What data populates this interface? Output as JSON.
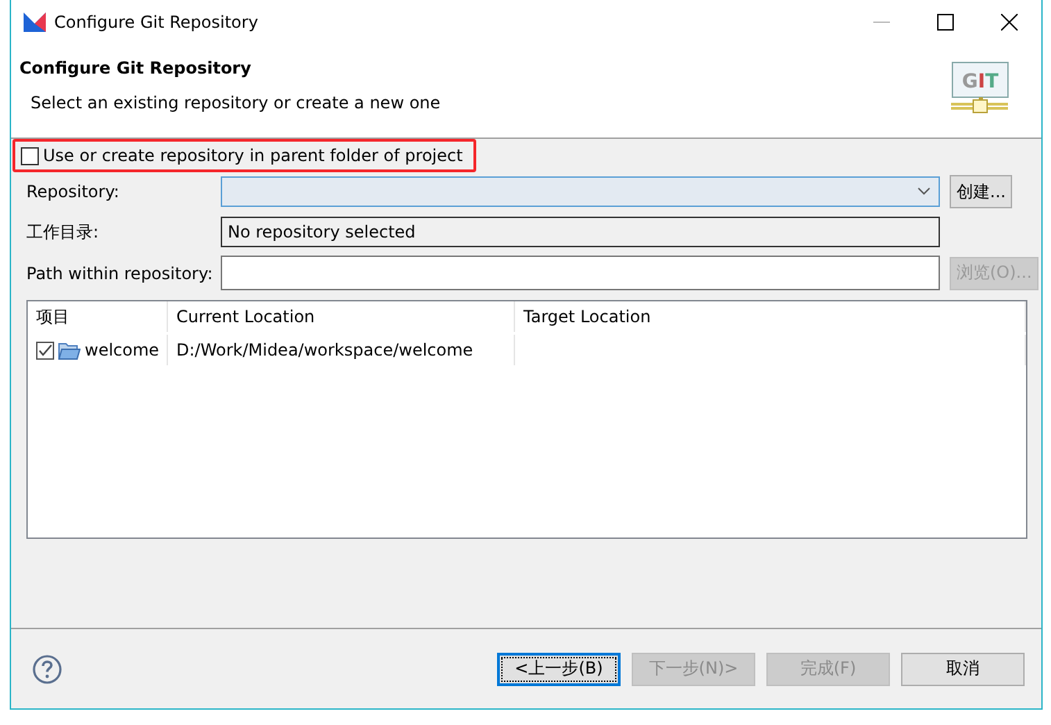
{
  "window": {
    "title": "Configure Git Repository"
  },
  "header": {
    "title": "Configure Git Repository",
    "description": "Select an existing repository or create a new one",
    "icon_text": "GIT"
  },
  "parent_option": {
    "label": "Use or create repository in parent folder of project",
    "checked": false,
    "highlighted": true
  },
  "fields": [
    {
      "kind": "combo",
      "label": "Repository:",
      "button": {
        "label": "创建...",
        "disabled": false
      }
    },
    {
      "kind": "readonly",
      "label": "工作目录:",
      "value": "No repository selected"
    },
    {
      "kind": "text",
      "label": "Path within repository:",
      "button": {
        "label": "浏览(O)...",
        "disabled": true
      }
    }
  ],
  "table": {
    "columns": [
      "项目",
      "Current Location",
      "Target Location"
    ],
    "rows": [
      {
        "checked": true,
        "project": "welcome",
        "current_location": "D:/Work/Midea/workspace/welcome"
      }
    ]
  },
  "buttons": [
    {
      "label": "<上一步(B)",
      "disabled": false,
      "focused": true
    },
    {
      "label": "下一步(N)>",
      "disabled": true,
      "focused": false
    },
    {
      "label": "完成(F)",
      "disabled": true,
      "focused": false
    },
    {
      "label": "取消",
      "disabled": false,
      "focused": false
    }
  ]
}
